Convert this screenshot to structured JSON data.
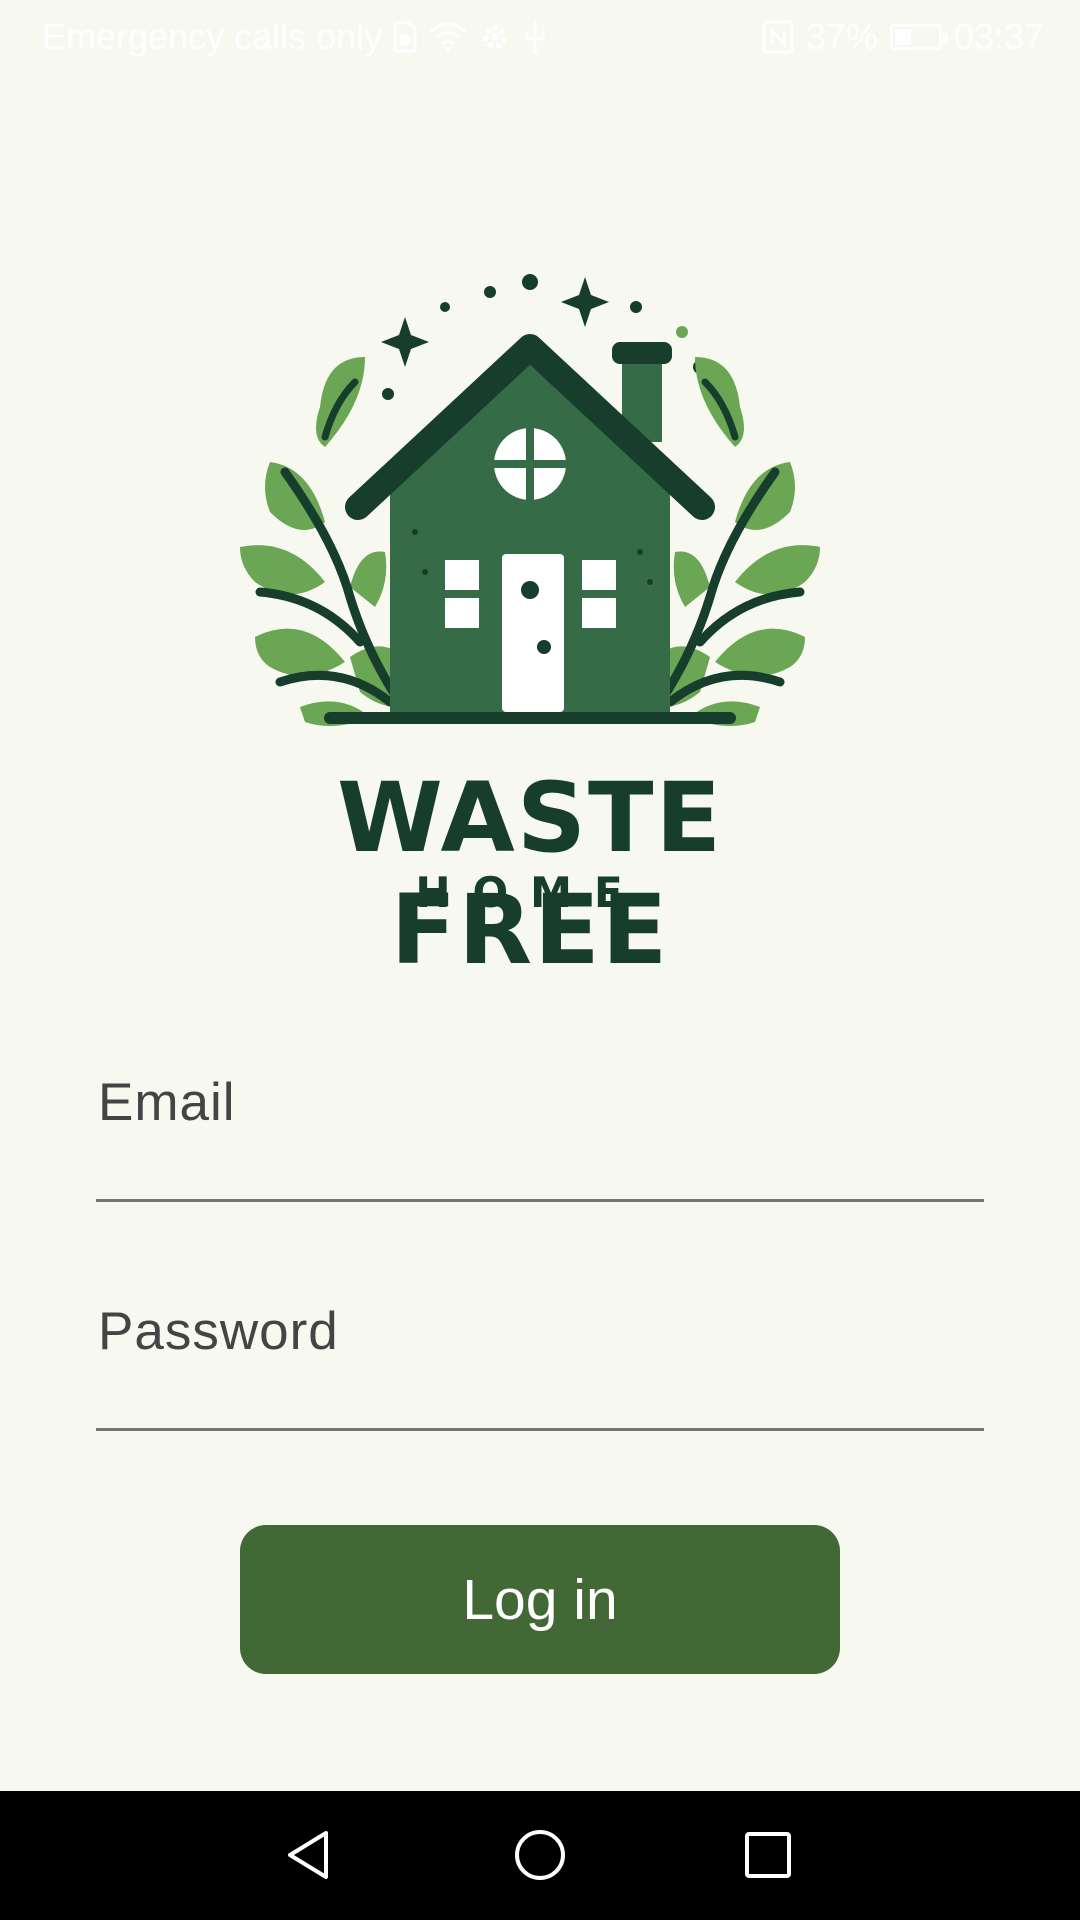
{
  "status_bar": {
    "carrier_text": "Emergency calls only",
    "battery_level": "37%",
    "battery_fraction": 0.37,
    "time": "03:37",
    "icons": [
      "sim-icon",
      "wifi-icon",
      "settings-icon",
      "usb-icon",
      "nfc-icon",
      "battery-icon"
    ]
  },
  "logo": {
    "title_line1": "WASTE FREE",
    "title_line2": "HOME",
    "colors": {
      "dark": "#173d2c",
      "house": "#356b47",
      "leaf": "#6aa654"
    }
  },
  "form": {
    "email_placeholder": "Email",
    "password_placeholder": "Password"
  },
  "login_button": {
    "label": "Log in",
    "color": "#426935"
  },
  "nav_bar": {
    "buttons": [
      "back-icon",
      "home-icon",
      "recents-icon"
    ]
  }
}
